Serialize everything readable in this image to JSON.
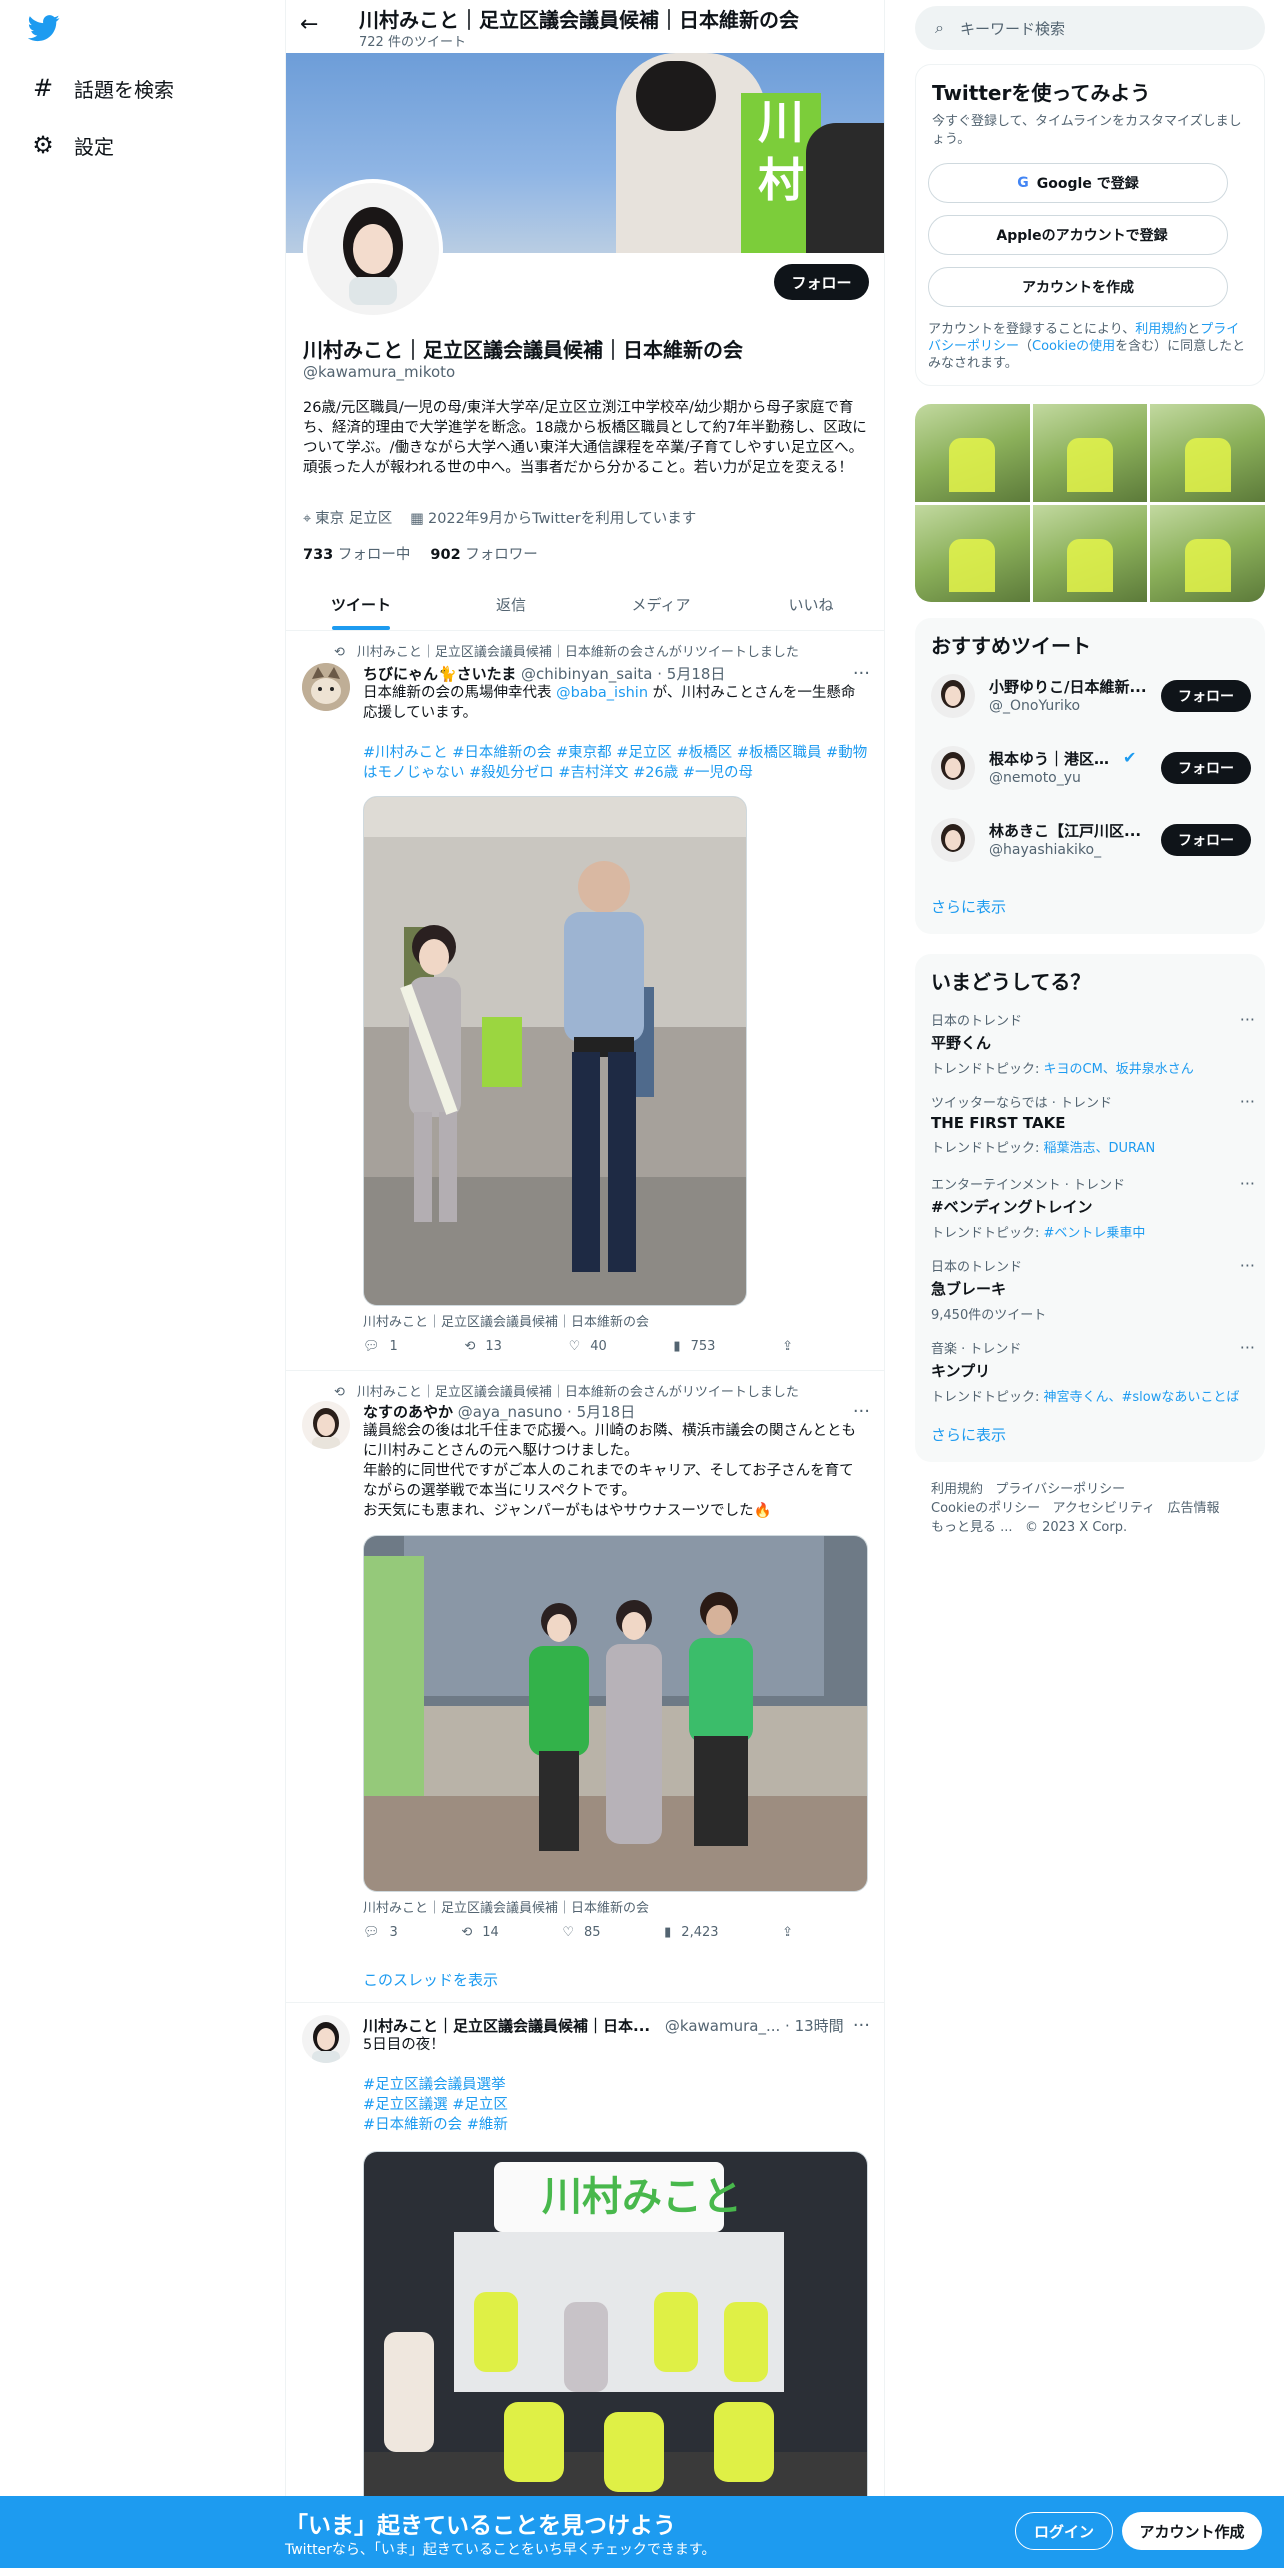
{
  "colors": {
    "accent": "#1d9bf0",
    "text": "#0f1419",
    "muted": "#536471",
    "campaign_green": "#7ccd3a"
  },
  "nav": {
    "logo_icon": "twitter-bird-icon",
    "items": [
      {
        "label": "話題を検索",
        "icon": "hashtag-icon"
      },
      {
        "label": "設定",
        "icon": "gear-icon"
      }
    ]
  },
  "header": {
    "title": "川村みこと｜足立区議会議員候補｜日本維新の会",
    "tweet_count": "722 件のツイート"
  },
  "banner": {
    "sign_text": "川村"
  },
  "profile": {
    "name": "川村みこと｜足立区議会議員候補｜日本維新の会",
    "handle": "@kawamura_mikoto",
    "follow_label": "フォロー",
    "bio": "26歳/元区職員/一児の母/東洋大学卒/足立区立渕江中学校卒/幼少期から母子家庭で育ち、経済的理由で大学進学を断念。18歳から板橋区職員として約7年半勤務し、区政について学ぶ。/働きながら大学へ通い東洋大通信課程を卒業/子育てしやすい足立区へ。頑張った人が報われる世の中へ。当事者だから分かること。若い力が足立を変える！",
    "location": "東京 足立区",
    "joined": "2022年9月からTwitterを利用しています",
    "following_count": "733",
    "following_label": "フォロー中",
    "followers_count": "902",
    "followers_label": "フォロワー"
  },
  "tabs": [
    {
      "label": "ツイート",
      "active": true
    },
    {
      "label": "返信",
      "active": false
    },
    {
      "label": "メディア",
      "active": false
    },
    {
      "label": "いいね",
      "active": false
    }
  ],
  "tweets": [
    {
      "retweet_note": "川村みこと｜足立区議会議員候補｜日本維新の会さんがリツイートしました",
      "author": "ちびにゃん🐈さいたま",
      "handle": "@chibinyan_saita",
      "time": "· 5月18日",
      "text_before": "日本維新の会の馬場伸幸代表 ",
      "mention": "@baba_ishin",
      "text_after": " が、川村みことさんを一生懸命応援しています。",
      "hashtags": "#川村みこと #日本維新の会 #東京都 #足立区 #板橋区 #板橋区職員 #動物はモノじゃない #殺処分ゼロ #吉村洋文 #26歳 #一児の母",
      "caption": "川村みこと｜足立区議会議員候補｜日本維新の会",
      "replies": "1",
      "retweets": "13",
      "likes": "40",
      "views": "753"
    },
    {
      "retweet_note": "川村みこと｜足立区議会議員候補｜日本維新の会さんがリツイートしました",
      "author": "なすのあやか",
      "handle": "@aya_nasuno",
      "time": "· 5月18日",
      "text": "議員総会の後は北千住まで応援へ。川崎のお隣、横浜市議会の関さんとともに川村みことさんの元へ駆けつけました。\n年齢的に同世代ですがご本人のこれまでのキャリア、そしてお子さんを育てながらの選挙戦で本当にリスペクトです。\nお天気にも恵まれ、ジャンパーがもはやサウナスーツでした🔥",
      "caption": "川村みこと｜足立区議会議員候補｜日本維新の会",
      "replies": "3",
      "retweets": "14",
      "likes": "85",
      "views": "2,423",
      "show_thread": "このスレッドを表示"
    },
    {
      "author": "川村みこと｜足立区議会議員候補｜日本...",
      "handle": "@kawamura_...",
      "time": "· 13時間",
      "text": "5日目の夜！",
      "hashtags": [
        "#足立区議会議員選挙",
        "#足立区議選 #足立区",
        "#日本維新の会 #維新"
      ],
      "image_sign": "川村みこと"
    }
  ],
  "right": {
    "search_placeholder": "キーワード検索",
    "signup_card": {
      "title": "Twitterを使ってみよう",
      "subtitle": "今すぐ登録して、タイムラインをカスタマイズしましょう。",
      "google_label": "Google で登録",
      "apple_label": "Appleのアカウントで登録",
      "create_label": "アカウントを作成",
      "legal_1": "アカウントを登録することにより、",
      "legal_terms": "利用規約",
      "legal_2": "と",
      "legal_privacy": "プライバシーポリシー",
      "legal_3": "（",
      "legal_cookie": "Cookieの使用",
      "legal_4": "を含む）に同意したとみなされます。"
    },
    "recommended": {
      "title": "おすすめツイート",
      "accounts": [
        {
          "name": "小野ゆりこ/日本維新...",
          "handle": "@_OnoYuriko",
          "follow": "フォロー"
        },
        {
          "name": "根本ゆう｜港区議...",
          "handle": "@nemoto_yu",
          "follow": "フォロー",
          "verified": true
        },
        {
          "name": "林あきこ【江戸川区...",
          "handle": "@hayashiakiko_",
          "follow": "フォロー"
        }
      ],
      "show_more": "さらに表示"
    },
    "trends": {
      "title": "いまどうしてる？",
      "items": [
        {
          "context": "日本のトレンド",
          "name": "平野くん",
          "sub_prefix": "トレンドトピック: ",
          "sub_link": "キヨのCM、坂井泉水さん"
        },
        {
          "context": "ツイッターならでは · トレンド",
          "name": "THE FIRST TAKE",
          "sub_prefix": "トレンドトピック: ",
          "sub_link": "稲葉浩志、DURAN"
        },
        {
          "context": "エンターテインメント · トレンド",
          "name": "#ベンディングトレイン",
          "sub_prefix": "トレンドトピック: ",
          "sub_link": "#ベントレ乗車中"
        },
        {
          "context": "日本のトレンド",
          "name": "急ブレーキ",
          "sub_prefix": "9,450件のツイート",
          "sub_link": ""
        },
        {
          "context": "音楽 · トレンド",
          "name": "キンプリ",
          "sub_prefix": "トレンドトピック: ",
          "sub_link": "神宮寺くん、#slowなあいことば"
        }
      ],
      "show_more": "さらに表示"
    },
    "footer": [
      "利用規約",
      "プライバシーポリシー",
      "Cookieのポリシー",
      "アクセシビリティ",
      "広告情報",
      "もっと見る ...",
      "© 2023 X Corp."
    ]
  },
  "bottom_bar": {
    "title": "「いま」起きていることを見つけよう",
    "subtitle": "Twitterなら、「いま」起きていることをいち早くチェックできます。",
    "login": "ログイン",
    "signup": "アカウント作成"
  }
}
